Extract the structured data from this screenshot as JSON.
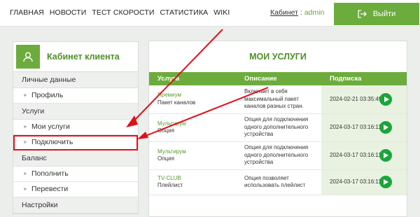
{
  "nav": [
    "ГЛАВНАЯ",
    "НОВОСТИ",
    "ТЕСТ СКОРОСТИ",
    "СТАТИСТИКА",
    "WIKI"
  ],
  "cabinet": {
    "label": "Кабинет",
    "sep": " : ",
    "user": "admin"
  },
  "logout": {
    "label": "Выйти",
    "icon": "logout-icon"
  },
  "sidebar": {
    "title": "Кабинет клиента",
    "icon": "user-icon",
    "sections": [
      {
        "label": "Личные данные",
        "items": [
          "Профиль"
        ]
      },
      {
        "label": "Услуги",
        "items": [
          "Мои услуги",
          "Подключить"
        ]
      },
      {
        "label": "Баланс",
        "items": [
          "Пополнить",
          "Перевести"
        ]
      },
      {
        "label": "Настройки",
        "items": []
      }
    ]
  },
  "main": {
    "title": "МОИ УСЛУГИ",
    "headers": [
      "Услуга",
      "Описание",
      "Подписка"
    ],
    "rows": [
      {
        "name": "Премиум",
        "type": "Пакет каналов",
        "desc": "Включает в себя максимальный пакет каналов разных стран.",
        "sub": "2024-02-21 03:35:49"
      },
      {
        "name": "Мультирум",
        "type": "Опция",
        "desc": "Опция для подключения одного дополнительного устройства",
        "sub": "2024-03-17 03:16:11"
      },
      {
        "name": "Мультирум",
        "type": "Опция",
        "desc": "Опция для подключения одного дополнительного устройства",
        "sub": "2024-03-17 03:16:11"
      },
      {
        "name": "TV-CLUB",
        "type": "Плейлист",
        "desc": "Опция позволяет использовать плейлист",
        "sub": "2024-03-17 03:16:11"
      }
    ]
  },
  "colors": {
    "accent": "#6cac3c",
    "highlight": "#e0111b",
    "play": "#1aa63a"
  }
}
